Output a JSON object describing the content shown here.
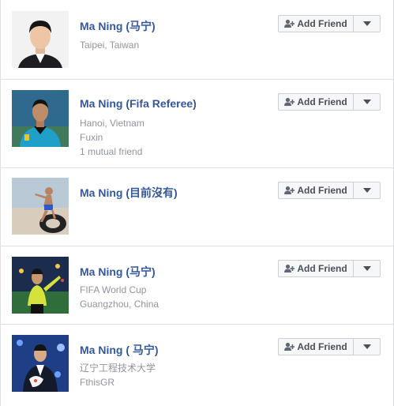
{
  "add_friend_label": "Add Friend",
  "icons": {
    "add": "add-friend-icon",
    "dropdown": "chevron-down-icon"
  },
  "colors": {
    "name_link": "#365899",
    "secondary_text": "#90949c",
    "button_bg": "#f6f7f9",
    "border": "#dddfe2"
  },
  "results": [
    {
      "name": "Ma Ning (马宁)",
      "details": [
        "Taipei, Taiwan"
      ]
    },
    {
      "name": "Ma Ning (Fifa Referee)",
      "details": [
        "Hanoi, Vietnam",
        "Fuxin",
        "1 mutual friend"
      ]
    },
    {
      "name": "Ma Ning (目前沒有)",
      "details": []
    },
    {
      "name": "Ma Ning (马宁)",
      "details": [
        "FIFA World Cup",
        "Guangzhou, China"
      ]
    },
    {
      "name": "Ma Ning ( 马宁)",
      "details": [
        "辽宁工程技术大学",
        "FthisGR"
      ]
    }
  ]
}
